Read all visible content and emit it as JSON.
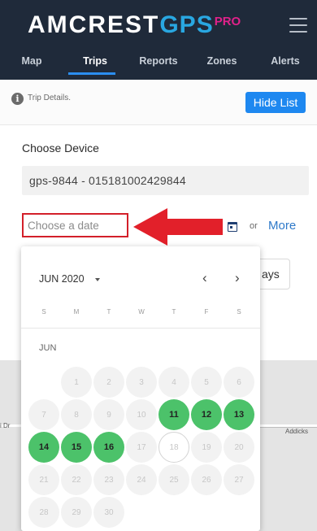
{
  "brand": {
    "main": "AMCREST",
    "gps": "GPS",
    "pro": "PRO"
  },
  "nav": {
    "tabs": [
      "Map",
      "Trips",
      "Reports",
      "Zones",
      "Alerts"
    ],
    "active": "Trips"
  },
  "info": {
    "text": "Trip Details.",
    "hide_list": "Hide List"
  },
  "device": {
    "label": "Choose Device",
    "value": "gps-9844 - 015181002429844"
  },
  "date": {
    "placeholder": "Choose a date",
    "or": "or",
    "more": "More",
    "days_partial": "ays"
  },
  "calendar": {
    "month_year": "JUN 2020",
    "weekdays": [
      "S",
      "M",
      "T",
      "W",
      "T",
      "F",
      "S"
    ],
    "month_label": "JUN",
    "weeks": [
      [
        {
          "d": ""
        },
        {
          "d": "1",
          "s": "dis"
        },
        {
          "d": "2",
          "s": "dis"
        },
        {
          "d": "3",
          "s": "dis"
        },
        {
          "d": "4",
          "s": "dis"
        },
        {
          "d": "5",
          "s": "dis"
        },
        {
          "d": "6",
          "s": "dis"
        }
      ],
      [
        {
          "d": "7",
          "s": "dis"
        },
        {
          "d": "8",
          "s": "dis"
        },
        {
          "d": "9",
          "s": "dis"
        },
        {
          "d": "10",
          "s": "dis"
        },
        {
          "d": "11",
          "s": "sel"
        },
        {
          "d": "12",
          "s": "sel"
        },
        {
          "d": "13",
          "s": "sel"
        }
      ],
      [
        {
          "d": "14",
          "s": "sel"
        },
        {
          "d": "15",
          "s": "sel"
        },
        {
          "d": "16",
          "s": "sel"
        },
        {
          "d": "17",
          "s": "dis"
        },
        {
          "d": "18",
          "s": "today"
        },
        {
          "d": "19",
          "s": "dis"
        },
        {
          "d": "20",
          "s": "dis"
        }
      ],
      [
        {
          "d": "21",
          "s": "dis"
        },
        {
          "d": "22",
          "s": "dis"
        },
        {
          "d": "23",
          "s": "dis"
        },
        {
          "d": "24",
          "s": "dis"
        },
        {
          "d": "25",
          "s": "dis"
        },
        {
          "d": "26",
          "s": "dis"
        },
        {
          "d": "27",
          "s": "dis"
        }
      ],
      [
        {
          "d": "28",
          "s": "dis"
        },
        {
          "d": "29",
          "s": "dis"
        },
        {
          "d": "30",
          "s": "dis"
        },
        {
          "d": ""
        },
        {
          "d": ""
        },
        {
          "d": ""
        },
        {
          "d": ""
        }
      ]
    ]
  },
  "map": {
    "label_left": "i Dr",
    "label_right": "Addicks"
  },
  "colors": {
    "header": "#1f2a3a",
    "accent": "#1e88f0",
    "selected": "#4cc26a",
    "highlight": "#d3202a"
  }
}
